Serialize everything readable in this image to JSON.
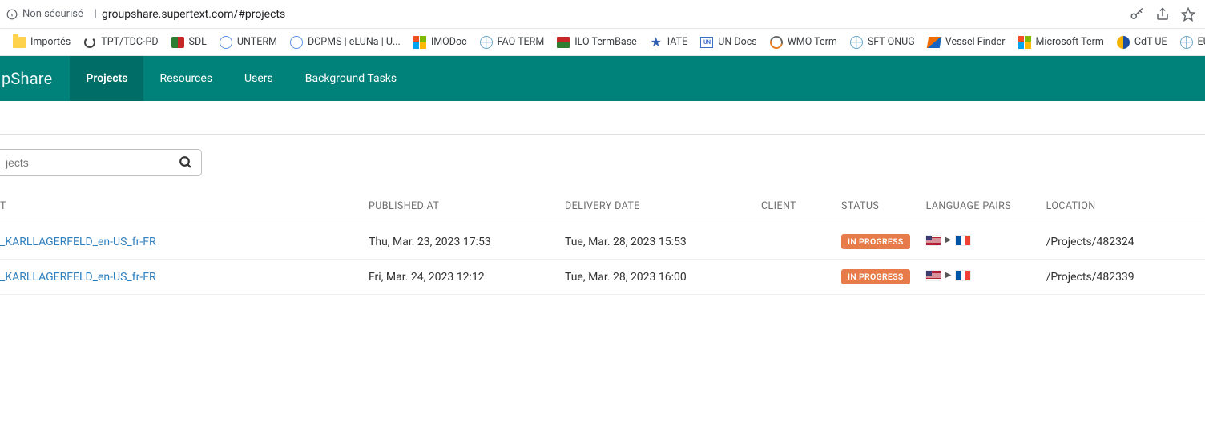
{
  "browser": {
    "security_label": "Non sécurisé",
    "url": "groupshare.supertext.com/#projects"
  },
  "bookmarks": [
    {
      "label": "Importés",
      "icon": "folder"
    },
    {
      "label": "TPT/TDC-PD",
      "icon": "swirl"
    },
    {
      "label": "SDL",
      "icon": "puzzle"
    },
    {
      "label": "UNTERM",
      "icon": "un"
    },
    {
      "label": "DCPMS | eLUNa | U...",
      "icon": "un"
    },
    {
      "label": "IMODoc",
      "icon": "ms"
    },
    {
      "label": "FAO TERM",
      "icon": "globe"
    },
    {
      "label": "ILO TermBase",
      "icon": "ilo"
    },
    {
      "label": "IATE",
      "icon": "star"
    },
    {
      "label": "UN Docs",
      "icon": "undocs"
    },
    {
      "label": "WMO Term",
      "icon": "wmo"
    },
    {
      "label": "SFT ONUG",
      "icon": "globe"
    },
    {
      "label": "Vessel Finder",
      "icon": "vessel"
    },
    {
      "label": "Microsoft Term",
      "icon": "ms"
    },
    {
      "label": "CdT UE",
      "icon": "cdt"
    },
    {
      "label": "EU-IPC",
      "icon": "globe"
    }
  ],
  "brand": "pShare",
  "nav": [
    {
      "label": "Projects",
      "active": true
    },
    {
      "label": "Resources",
      "active": false
    },
    {
      "label": "Users",
      "active": false
    },
    {
      "label": "Background Tasks",
      "active": false
    }
  ],
  "search": {
    "placeholder": "jects"
  },
  "columns": {
    "project": "T",
    "published": "PUBLISHED AT",
    "delivery": "DELIVERY DATE",
    "client": "CLIENT",
    "status": "STATUS",
    "language_pairs": "LANGUAGE PAIRS",
    "location": "LOCATION"
  },
  "status_label": "IN PROGRESS",
  "rows": [
    {
      "project": "_KARLLAGERFELD_en-US_fr-FR",
      "published": "Thu, Mar. 23, 2023 17:53",
      "delivery": "Tue, Mar. 28, 2023 15:53",
      "client": "",
      "lang_from": "us",
      "lang_to": "fr",
      "location": "/Projects/482324"
    },
    {
      "project": "_KARLLAGERFELD_en-US_fr-FR",
      "published": "Fri, Mar. 24, 2023 12:12",
      "delivery": "Tue, Mar. 28, 2023 16:00",
      "client": "",
      "lang_from": "us",
      "lang_to": "fr",
      "location": "/Projects/482339"
    }
  ]
}
